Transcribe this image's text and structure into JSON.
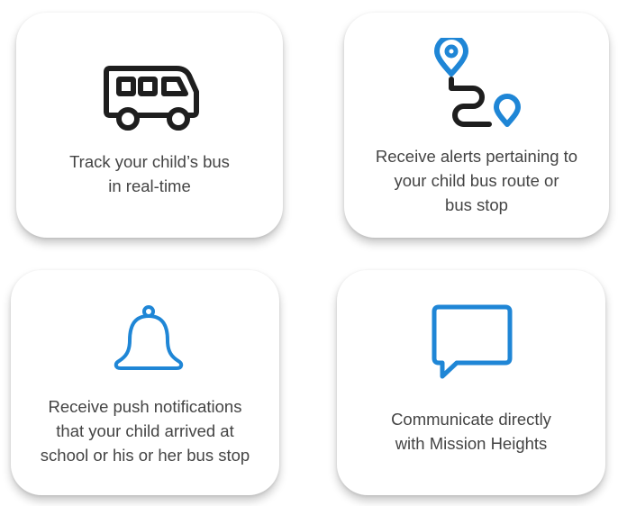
{
  "features": [
    {
      "icon": "bus-icon",
      "text": "Track your child’s bus\nin real-time"
    },
    {
      "icon": "route-icon",
      "text": "Receive alerts pertaining to\nyour child bus route or\nbus stop"
    },
    {
      "icon": "bell-icon",
      "text": "Receive push notifications\nthat your child arrived at\nschool  or his or her bus stop"
    },
    {
      "icon": "chat-icon",
      "text": "Communicate directly\nwith Mission Heights"
    }
  ],
  "colors": {
    "bus_icon": "#1e1e1e",
    "accent_blue": "#1f86d6",
    "text": "#444444"
  }
}
